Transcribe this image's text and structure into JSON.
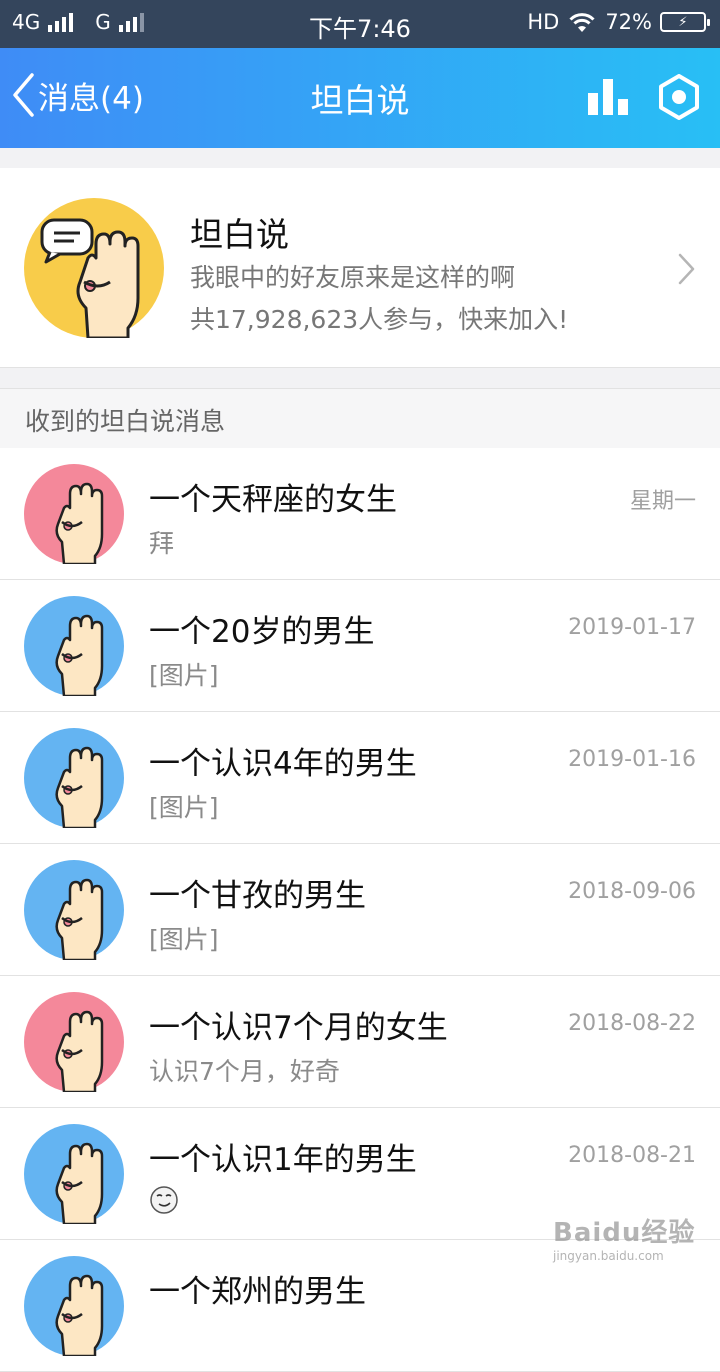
{
  "status_bar": {
    "network_1": "4G",
    "network_2": "G",
    "time": "下午7:46",
    "hd": "HD",
    "battery_percent": "72%"
  },
  "nav": {
    "back_label": "消息(4)",
    "title": "坦白说",
    "stats_icon": "bar-chart-icon",
    "settings_icon": "hexagon-settings-icon"
  },
  "hero": {
    "title": "坦白说",
    "subtitle": "我眼中的好友原来是这样的啊",
    "participants": "共17,928,623人参与，快来加入!"
  },
  "section_header": "收到的坦白说消息",
  "messages": [
    {
      "name": "一个天秤座的女生",
      "date": "星期一",
      "preview": "拜",
      "gender": "female"
    },
    {
      "name": "一个20岁的男生",
      "date": "2019-01-17",
      "preview": "[图片]",
      "gender": "male"
    },
    {
      "name": "一个认识4年的男生",
      "date": "2019-01-16",
      "preview": "[图片]",
      "gender": "male"
    },
    {
      "name": "一个甘孜的男生",
      "date": "2018-09-06",
      "preview": "[图片]",
      "gender": "male"
    },
    {
      "name": "一个认识7个月的女生",
      "date": "2018-08-22",
      "preview": "认识7个月，好奇",
      "gender": "female"
    },
    {
      "name": "一个认识1年的男生",
      "date": "2018-08-21",
      "preview": "",
      "preview_icon": "smirk-emoji-icon",
      "gender": "male"
    },
    {
      "name": "一个郑州的男生",
      "date": "",
      "preview": "",
      "gender": "male"
    }
  ],
  "colors": {
    "status_bar": "#34455c",
    "nav_gradient_start": "#3f8cf6",
    "nav_gradient_end": "#28bff5",
    "female_avatar": "#f4889a",
    "male_avatar": "#64b4f2",
    "hero_avatar": "#f8cc4a"
  },
  "watermark": {
    "main": "Baidu经验",
    "sub": "jingyan.baidu.com"
  }
}
